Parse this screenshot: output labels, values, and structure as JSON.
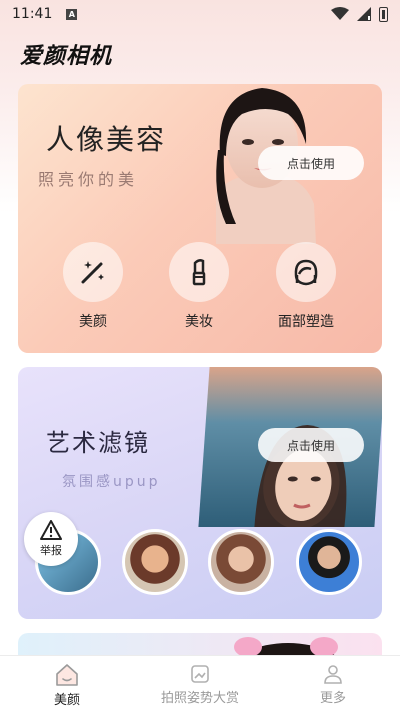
{
  "status_bar": {
    "time": "11:41",
    "a_icon": "A",
    "icons": [
      "wifi-icon",
      "signal-icon",
      "battery-icon"
    ]
  },
  "app": {
    "title": "爱颜相机"
  },
  "cards": {
    "beauty": {
      "title": "人像美容",
      "subtitle": "照亮你的美",
      "button": "点击使用",
      "features": [
        {
          "label": "美颜",
          "icon": "magic-wand-icon"
        },
        {
          "label": "美妆",
          "icon": "lipstick-icon"
        },
        {
          "label": "面部塑造",
          "icon": "face-shape-icon"
        }
      ]
    },
    "filter": {
      "title": "艺术滤镜",
      "subtitle": "氛围感upup",
      "button": "点击使用"
    }
  },
  "report": {
    "label": "举报",
    "icon": "warning-icon"
  },
  "bottom_nav": {
    "items": [
      {
        "label": "美颜",
        "icon": "home-icon",
        "active": true
      },
      {
        "label": "拍照姿势大赏",
        "icon": "photo-icon",
        "active": false
      },
      {
        "label": "更多",
        "icon": "person-icon",
        "active": false
      }
    ]
  },
  "colors": {
    "beauty_card": "#f7b9a8",
    "filter_card": "#d9d6f6",
    "active_nav": "#222222",
    "inactive_nav": "#9a9a9a"
  }
}
